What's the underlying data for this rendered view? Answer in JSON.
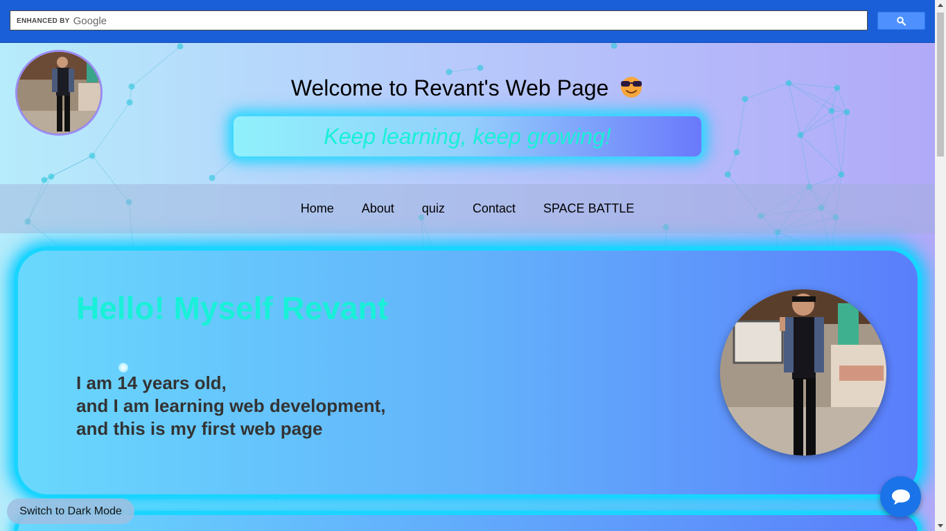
{
  "search": {
    "enhanced_label": "ENHANCED BY",
    "brand": "Google",
    "value": "",
    "button_icon": "search-icon"
  },
  "header": {
    "title": "Welcome to Revant's Web Page",
    "title_emoji": "sunglasses-face-icon",
    "motto": "Keep learning, keep growing!"
  },
  "nav": {
    "items": [
      {
        "label": "Home"
      },
      {
        "label": "About"
      },
      {
        "label": "quiz"
      },
      {
        "label": "Contact"
      },
      {
        "label": "SPACE BATTLE"
      }
    ]
  },
  "hero": {
    "heading": "Hello! Myself Revant",
    "lines": [
      "I am 14 years old,",
      "and I am learning web development,",
      "and this is my first web page"
    ]
  },
  "controls": {
    "dark_mode_label": "Switch to Dark Mode",
    "chat_icon": "chat-bubble-icon"
  },
  "colors": {
    "accent_cyan": "#19d5ff",
    "heading_teal": "#19f0d8",
    "search_bar_blue": "#1a5fd8",
    "search_button": "#4d90fe",
    "chat_button": "#1a73e8"
  }
}
